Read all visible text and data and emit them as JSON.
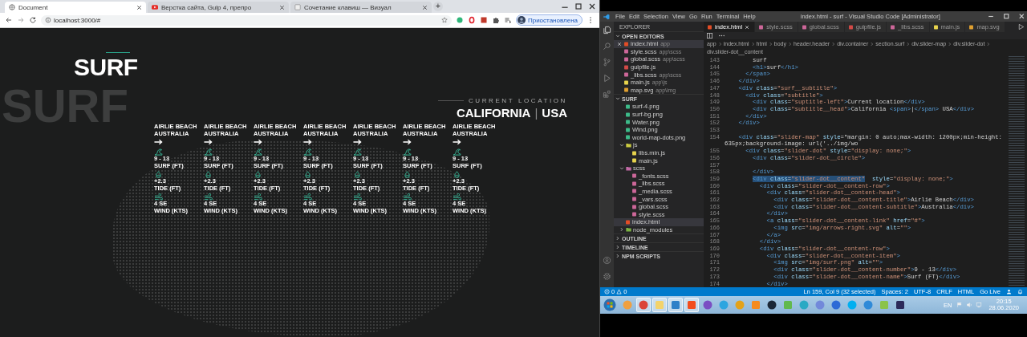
{
  "browser": {
    "tabs": [
      {
        "title": "Document",
        "selected": true
      },
      {
        "title": "Верстка сайта, Gulp 4, препро",
        "selected": false
      },
      {
        "title": "Сочетание клавиш — Визуал",
        "selected": false
      }
    ],
    "new_tab": "+",
    "url": "localhost:3000/#",
    "profile": "Приостановлена"
  },
  "page": {
    "ghost_word": "SURF",
    "title": "SURF",
    "location_label": "CURRENT LOCATION",
    "location_city": "CALIFORNIA",
    "location_separator": "|",
    "location_country": "USA",
    "spots": [
      {
        "title": "AIRLIE BEACH",
        "subtitle": "AUSTRALIA",
        "stats": [
          {
            "kind": "surf",
            "value": "9 - 13",
            "label": "SURF (FT)"
          },
          {
            "kind": "tide",
            "value": "+2.3",
            "label": "TIDE (FT)"
          },
          {
            "kind": "wind",
            "value": "4 SE",
            "label": "WIND (KTS)"
          }
        ]
      },
      {
        "title": "AIRLIE BEACH",
        "subtitle": "AUSTRALIA",
        "stats": [
          {
            "kind": "surf",
            "value": "9 - 13",
            "label": "SURF (FT)"
          },
          {
            "kind": "tide",
            "value": "+2.3",
            "label": "TIDE (FT)"
          },
          {
            "kind": "wind",
            "value": "4 SE",
            "label": "WIND (KTS)"
          }
        ]
      },
      {
        "title": "AIRLIE BEACH",
        "subtitle": "AUSTRALIA",
        "stats": [
          {
            "kind": "surf",
            "value": "9 - 13",
            "label": "SURF (FT)"
          },
          {
            "kind": "tide",
            "value": "+2.3",
            "label": "TIDE (FT)"
          },
          {
            "kind": "wind",
            "value": "4 SE",
            "label": "WIND (KTS)"
          }
        ]
      },
      {
        "title": "AIRLIE BEACH",
        "subtitle": "AUSTRALIA",
        "stats": [
          {
            "kind": "surf",
            "value": "9 - 13",
            "label": "SURF (FT)"
          },
          {
            "kind": "tide",
            "value": "+2.3",
            "label": "TIDE (FT)"
          },
          {
            "kind": "wind",
            "value": "4 SE",
            "label": "WIND (KTS)"
          }
        ]
      },
      {
        "title": "AIRLIE BEACH",
        "subtitle": "AUSTRALIA",
        "stats": [
          {
            "kind": "surf",
            "value": "9 - 13",
            "label": "SURF (FT)"
          },
          {
            "kind": "tide",
            "value": "+2.3",
            "label": "TIDE (FT)"
          },
          {
            "kind": "wind",
            "value": "4 SE",
            "label": "WIND (KTS)"
          }
        ]
      },
      {
        "title": "AIRLIE BEACH",
        "subtitle": "AUSTRALIA",
        "stats": [
          {
            "kind": "surf",
            "value": "9 - 13",
            "label": "SURF (FT)"
          },
          {
            "kind": "tide",
            "value": "+2.3",
            "label": "TIDE (FT)"
          },
          {
            "kind": "wind",
            "value": "4 SE",
            "label": "WIND (KTS)"
          }
        ]
      },
      {
        "title": "AIRLIE BEACH",
        "subtitle": "AUSTRALIA",
        "stats": [
          {
            "kind": "surf",
            "value": "9 - 13",
            "label": "SURF (FT)"
          },
          {
            "kind": "tide",
            "value": "+2.3",
            "label": "TIDE (FT)"
          },
          {
            "kind": "wind",
            "value": "4 SE",
            "label": "WIND (KTS)"
          }
        ]
      }
    ]
  },
  "vscode": {
    "menu": [
      "File",
      "Edit",
      "Selection",
      "View",
      "Go",
      "Run",
      "Terminal",
      "Help"
    ],
    "title": "index.html - surf - Visual Studio Code [Administrator]",
    "explorer_heading": "EXPLORER",
    "sections": [
      {
        "title": "OPEN EDITORS",
        "expanded": true,
        "items": [
          {
            "name": "index.html",
            "path": "app",
            "kind": "html",
            "selected": true
          },
          {
            "name": "style.scss",
            "path": "app\\scss",
            "kind": "scss",
            "selected": false
          },
          {
            "name": "global.scss",
            "path": "app\\scss",
            "kind": "scss",
            "selected": false
          },
          {
            "name": "gulpfile.js",
            "kind": "gulp",
            "selected": false
          },
          {
            "name": "_libs.scss",
            "path": "app\\scss",
            "kind": "scss",
            "selected": false
          },
          {
            "name": "main.js",
            "path": "app\\js",
            "kind": "js",
            "selected": false
          },
          {
            "name": "map.svg",
            "path": "app\\img",
            "kind": "svg",
            "selected": false
          }
        ]
      },
      {
        "title": "SURF",
        "expanded": true,
        "items": [
          {
            "name": "surf-4.png",
            "kind": "png",
            "selected": false
          },
          {
            "name": "surf-bg.png",
            "kind": "png",
            "selected": false
          },
          {
            "name": "Water.png",
            "kind": "png",
            "selected": false
          },
          {
            "name": "Wind.png",
            "kind": "png",
            "selected": false
          },
          {
            "name": "world-map-dots.png",
            "kind": "png",
            "selected": false
          },
          {
            "name": "js",
            "kind": "folder-js",
            "expanded": true,
            "selected": false,
            "children": [
              {
                "name": "libs.min.js",
                "kind": "js",
                "selected": false
              },
              {
                "name": "main.js",
                "kind": "js",
                "selected": false
              }
            ]
          },
          {
            "name": "scss",
            "kind": "folder-scss",
            "expanded": true,
            "selected": false,
            "children": [
              {
                "name": "_fonts.scss",
                "kind": "scss",
                "selected": false
              },
              {
                "name": "_libs.scss",
                "kind": "scss",
                "selected": false
              },
              {
                "name": "_media.scss",
                "kind": "scss",
                "selected": false
              },
              {
                "name": "_vars.scss",
                "kind": "scss",
                "selected": false
              },
              {
                "name": "global.scss",
                "kind": "scss",
                "selected": false
              },
              {
                "name": "style.scss",
                "kind": "scss",
                "selected": false
              }
            ]
          },
          {
            "name": "index.html",
            "kind": "html",
            "selected": true
          },
          {
            "name": "node_modules",
            "kind": "folder",
            "expanded": false,
            "selected": false
          }
        ]
      },
      {
        "title": "OUTLINE",
        "expanded": false
      },
      {
        "title": "TIMELINE",
        "expanded": false
      },
      {
        "title": "NPM SCRIPTS",
        "expanded": false
      }
    ],
    "tabs": [
      {
        "name": "index.html",
        "kind": "html",
        "selected": true
      },
      {
        "name": "style.scss",
        "kind": "scss",
        "selected": false
      },
      {
        "name": "global.scss",
        "kind": "scss",
        "selected": false
      },
      {
        "name": "gulpfile.js",
        "kind": "gulp",
        "selected": false
      },
      {
        "name": "_libs.scss",
        "kind": "scss",
        "selected": false
      },
      {
        "name": "main.js",
        "kind": "js",
        "selected": false
      },
      {
        "name": "map.svg",
        "kind": "svg",
        "selected": false
      }
    ],
    "breadcrumb": [
      "app",
      "index.html",
      "html",
      "body",
      "header.header",
      "div.container",
      "section.surf",
      "div.slider-map",
      "div.slider-dot",
      "div.slider-dot__content"
    ],
    "lines": [
      {
        "number": "143",
        "text": "        surf"
      },
      {
        "number": "144",
        "text": "        <h1>surf</h1>"
      },
      {
        "number": "145",
        "text": "      </span>"
      },
      {
        "number": "146",
        "text": "    </div>"
      },
      {
        "number": "147",
        "text": "    <div class=\"surf__subtitle\">"
      },
      {
        "number": "148",
        "text": "      <div class=\"subtitle\">"
      },
      {
        "number": "149",
        "text": "        <div class=\"suptitle-left\">Current location</div>"
      },
      {
        "number": "150",
        "text": "        <div class=\"subtitle__head\">California <span>|</span> USA</div>"
      },
      {
        "number": "151",
        "text": "      </div>"
      },
      {
        "number": "152",
        "text": "    </div>"
      },
      {
        "number": "153"
      },
      {
        "number": "154",
        "text": "    <div class=\"slider-map\" style=\"margin: 0 auto;max-width: 1200px;min-height: 635px;background-image: url('../img/wo"
      },
      {
        "number": "155",
        "text": "      <div class=\"slider-dot\" style=\"display: none;\">"
      },
      {
        "number": "156",
        "text": "        <div class=\"slider-dot__circle\">"
      },
      {
        "number": "157"
      },
      {
        "number": "158",
        "text": "        </div>"
      },
      {
        "number": "159",
        "selection": "        <div class=\"slider-dot__content\"",
        "after": "  style=\"display: none;\">"
      },
      {
        "number": "160",
        "text": "          <div class=\"slider-dot__content-row\">"
      },
      {
        "number": "161",
        "text": "            <div class=\"slider-dot__content-head\">"
      },
      {
        "number": "162",
        "text": "              <div class=\"slider-dot__content-title\">Airlie Beach</div>"
      },
      {
        "number": "163",
        "text": "              <div class=\"slider-dot__content-subtitle\">Australia</div>"
      },
      {
        "number": "164",
        "text": "            </div>"
      },
      {
        "number": "165",
        "text": "            <a class=\"slider-dot__content-link\" href=\"#\">"
      },
      {
        "number": "166",
        "text": "              <img src=\"img/arrows-right.svg\" alt=\"\">"
      },
      {
        "number": "167",
        "text": "            </a>"
      },
      {
        "number": "168",
        "text": "          </div>"
      },
      {
        "number": "169",
        "text": "          <div class=\"slider-dot__content-row\">"
      },
      {
        "number": "170",
        "text": "            <div class=\"slider-dot__content-item\">"
      },
      {
        "number": "171",
        "text": "              <img src=\"img/surf.png\" alt=\"\">"
      },
      {
        "number": "172",
        "text": "              <div class=\"slider-dot__content-number\">9 - 13</div>"
      },
      {
        "number": "173",
        "text": "              <div class=\"slider-dot__content-name\">Surf (FT)</div>"
      },
      {
        "number": "174",
        "text": "            </div>"
      }
    ],
    "status_bar": {
      "errors": "0",
      "warnings": "0",
      "items": [
        "Ln 159, Col 9 (32 selected)",
        "Spaces: 2",
        "UTF-8",
        "CRLF",
        "HTML",
        "Go Live"
      ]
    }
  },
  "taskbar": {
    "apps": [
      {
        "kind": "circle",
        "color": "#f0a040",
        "running": false
      },
      {
        "kind": "circle",
        "color": "#db4437",
        "running": true
      },
      {
        "kind": "square",
        "color": "#f3d36b",
        "running": true
      },
      {
        "kind": "square",
        "color": "#2f80c8",
        "running": true
      },
      {
        "kind": "square",
        "color": "#f24e1e",
        "running": true
      },
      {
        "kind": "circle",
        "color": "#7a4fc3",
        "running": false
      },
      {
        "kind": "circle",
        "color": "#2ca5e0",
        "running": false
      },
      {
        "kind": "circle",
        "color": "#e3a21a",
        "running": false
      },
      {
        "kind": "square",
        "color": "#f58b1f",
        "running": false
      },
      {
        "kind": "circle",
        "color": "#1b2838",
        "running": false
      },
      {
        "kind": "square",
        "color": "#62b94e",
        "running": false
      },
      {
        "kind": "circle",
        "color": "#29a9c4",
        "running": false
      },
      {
        "kind": "circle",
        "color": "#7289da",
        "running": false
      },
      {
        "kind": "circle",
        "color": "#2d6ad6",
        "running": false
      },
      {
        "kind": "circle",
        "color": "#00aff0",
        "running": false
      },
      {
        "kind": "circle",
        "color": "#2f8ad8",
        "running": false
      },
      {
        "kind": "square",
        "color": "#8bc34a",
        "running": false
      },
      {
        "kind": "square",
        "color": "#2c2a5a",
        "running": false
      }
    ],
    "language": "EN",
    "time": "20:15",
    "date": "28.06.2020"
  }
}
